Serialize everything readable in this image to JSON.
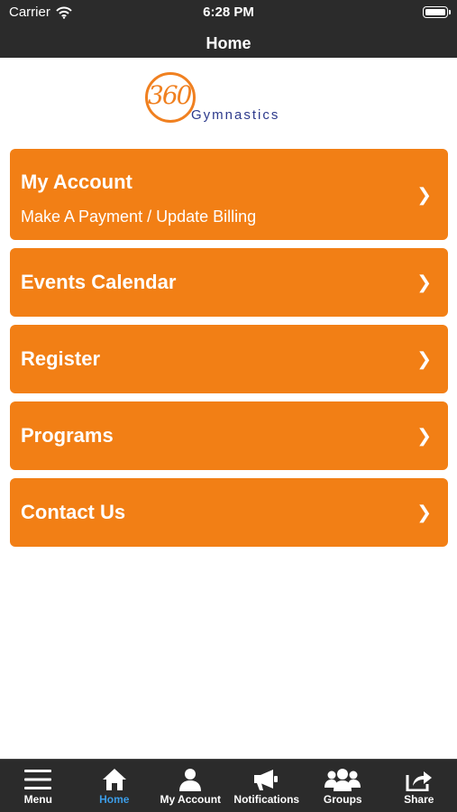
{
  "status": {
    "carrier": "Carrier",
    "time": "6:28 PM"
  },
  "header": {
    "title": "Home"
  },
  "logo": {
    "number": "360",
    "word": "Gymnastics"
  },
  "menu": [
    {
      "title": "My Account",
      "subtitle": "Make A Payment / Update Billing",
      "chevron": "❯"
    },
    {
      "title": "Events Calendar",
      "chevron": "❯"
    },
    {
      "title": "Register",
      "chevron": "❯"
    },
    {
      "title": "Programs",
      "chevron": "❯"
    },
    {
      "title": "Contact Us",
      "chevron": "❯"
    }
  ],
  "tabs": [
    {
      "label": "Menu",
      "icon": "hamburger-icon"
    },
    {
      "label": "Home",
      "icon": "home-icon",
      "active": true
    },
    {
      "label": "My Account",
      "icon": "person-icon"
    },
    {
      "label": "Notifications",
      "icon": "megaphone-icon"
    },
    {
      "label": "Groups",
      "icon": "group-icon"
    },
    {
      "label": "Share",
      "icon": "share-icon"
    }
  ],
  "colors": {
    "bar": "#2b2b2b",
    "accent": "#f27f15",
    "active_tab": "#3c9ce6",
    "logo_text": "#2d3a8c"
  }
}
